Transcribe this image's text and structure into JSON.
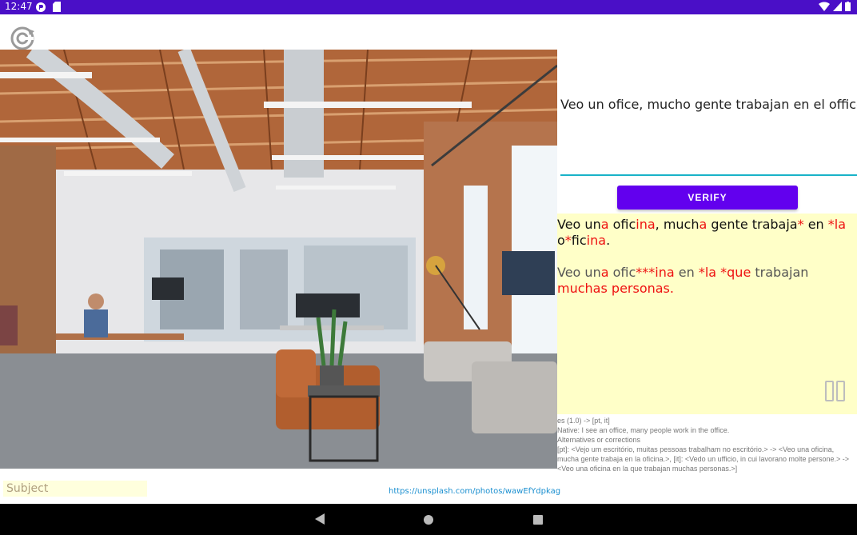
{
  "status_bar": {
    "time": "12:47"
  },
  "answer": {
    "text": "Veo un ofice, mucho gente trabajan en el office."
  },
  "verify_button": {
    "label": "VERIFY"
  },
  "result": {
    "correction_segments": [
      {
        "t": "Veo un",
        "r": false
      },
      {
        "t": "a",
        "r": true
      },
      {
        "t": " ofic",
        "r": false
      },
      {
        "t": "ina",
        "r": true
      },
      {
        "t": ", much",
        "r": false
      },
      {
        "t": "a",
        "r": true
      },
      {
        "t": " gente trabaja",
        "r": false
      },
      {
        "t": "*",
        "r": true
      },
      {
        "t": " en ",
        "r": false
      },
      {
        "t": "*la",
        "r": true
      },
      {
        "t": " o",
        "r": false
      },
      {
        "t": "*",
        "r": true
      },
      {
        "t": "fic",
        "r": false
      },
      {
        "t": "ina",
        "r": true
      },
      {
        "t": ".",
        "r": false
      }
    ],
    "alternative_segments": [
      {
        "t": "Veo un",
        "r": false
      },
      {
        "t": "a",
        "r": true
      },
      {
        "t": " ofic",
        "r": false
      },
      {
        "t": "***ina",
        "r": true
      },
      {
        "t": " en ",
        "r": false
      },
      {
        "t": "*la *que",
        "r": true
      },
      {
        "t": " trabajan ",
        "r": false
      },
      {
        "t": "muchas",
        "r": true
      },
      {
        "t": " ",
        "r": false
      },
      {
        "t": "personas.",
        "r": true
      }
    ]
  },
  "info": {
    "lines": [
      "es (1.0) -> [pt, it]",
      "Native: I see an office, many people work in the office.",
      "Alternatives or corrections",
      "[pt]: <Vejo um escritório, muitas pessoas trabalham no escritório.> -> <Veo una oficina, mucha gente trabaja en la oficina.>, [it]: <Vedo un ufficio, in cui lavorano molte persone.> -> <Veo una oficina en la que trabajan muchas personas.>]"
    ]
  },
  "subject": {
    "placeholder": "Subject"
  },
  "photo_credit": {
    "url": "https://unsplash.com/photos/wawEfYdpkag"
  },
  "colors": {
    "accent": "#6200ee",
    "status_bar": "#4a0fc7",
    "highlight": "#ffffc8",
    "error": "#ee1111",
    "underline": "#19b3c8"
  }
}
